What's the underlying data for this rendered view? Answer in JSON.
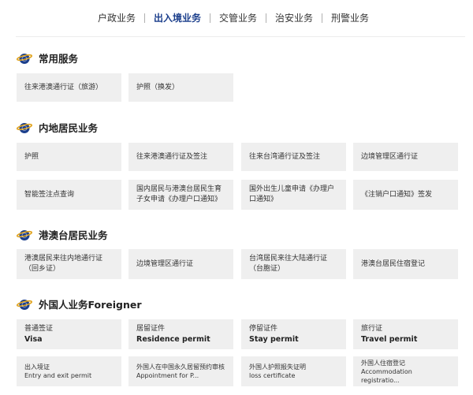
{
  "tabs": [
    {
      "label": "户政业务"
    },
    {
      "label": "出入境业务",
      "active": true
    },
    {
      "label": "交管业务"
    },
    {
      "label": "治安业务"
    },
    {
      "label": "刑警业务"
    }
  ],
  "sections": [
    {
      "title": "常用服务"
    },
    {
      "title": "内地居民业务"
    },
    {
      "title": "港澳台居民业务"
    },
    {
      "title": "外国人业务Foreigner"
    }
  ],
  "common": [
    {
      "label": "往来港澳通行证（旅游）"
    },
    {
      "label": "护照（换发）"
    }
  ],
  "mainland": [
    {
      "label": "护照"
    },
    {
      "label": "往来港澳通行证及签注"
    },
    {
      "label": "往来台湾通行证及签注"
    },
    {
      "label": "边境管理区通行证"
    },
    {
      "label": "智能签注点查询"
    },
    {
      "label": "国内居民与港澳台居民生育子女申请《办理户口通知》"
    },
    {
      "label": "国外出生儿童申请《办理户口通知》"
    },
    {
      "label": "《注销户口通知》签发"
    }
  ],
  "hkmt": [
    {
      "label": "港澳居民来往内地通行证（回乡证）"
    },
    {
      "label": "边境管理区通行证"
    },
    {
      "label": "台湾居民来往大陆通行证（台胞证）"
    },
    {
      "label": "港澳台居民住宿登记"
    }
  ],
  "foreigner": [
    {
      "zh": "普通签证",
      "en": "Visa"
    },
    {
      "zh": "居留证件",
      "en": "Residence permit"
    },
    {
      "zh": "停留证件",
      "en": "Stay permit"
    },
    {
      "zh": "旅行证",
      "en": "Travel permit"
    },
    {
      "zh": "出入境证",
      "en": "Entry and exit permit"
    },
    {
      "zh": "外国人在中国永久居留预约审核",
      "en": "Appointment for P..."
    },
    {
      "zh": "外国人护照报失证明",
      "en": "loss certificate"
    },
    {
      "zh": "外国人住宿登记",
      "en": "Accommodation registratio..."
    }
  ],
  "colors": {
    "accent": "#1c3f8c",
    "card_bg": "#efefef",
    "icon_gold": "#e0a21b"
  },
  "icons": {
    "section": "globe-emblem-icon"
  }
}
